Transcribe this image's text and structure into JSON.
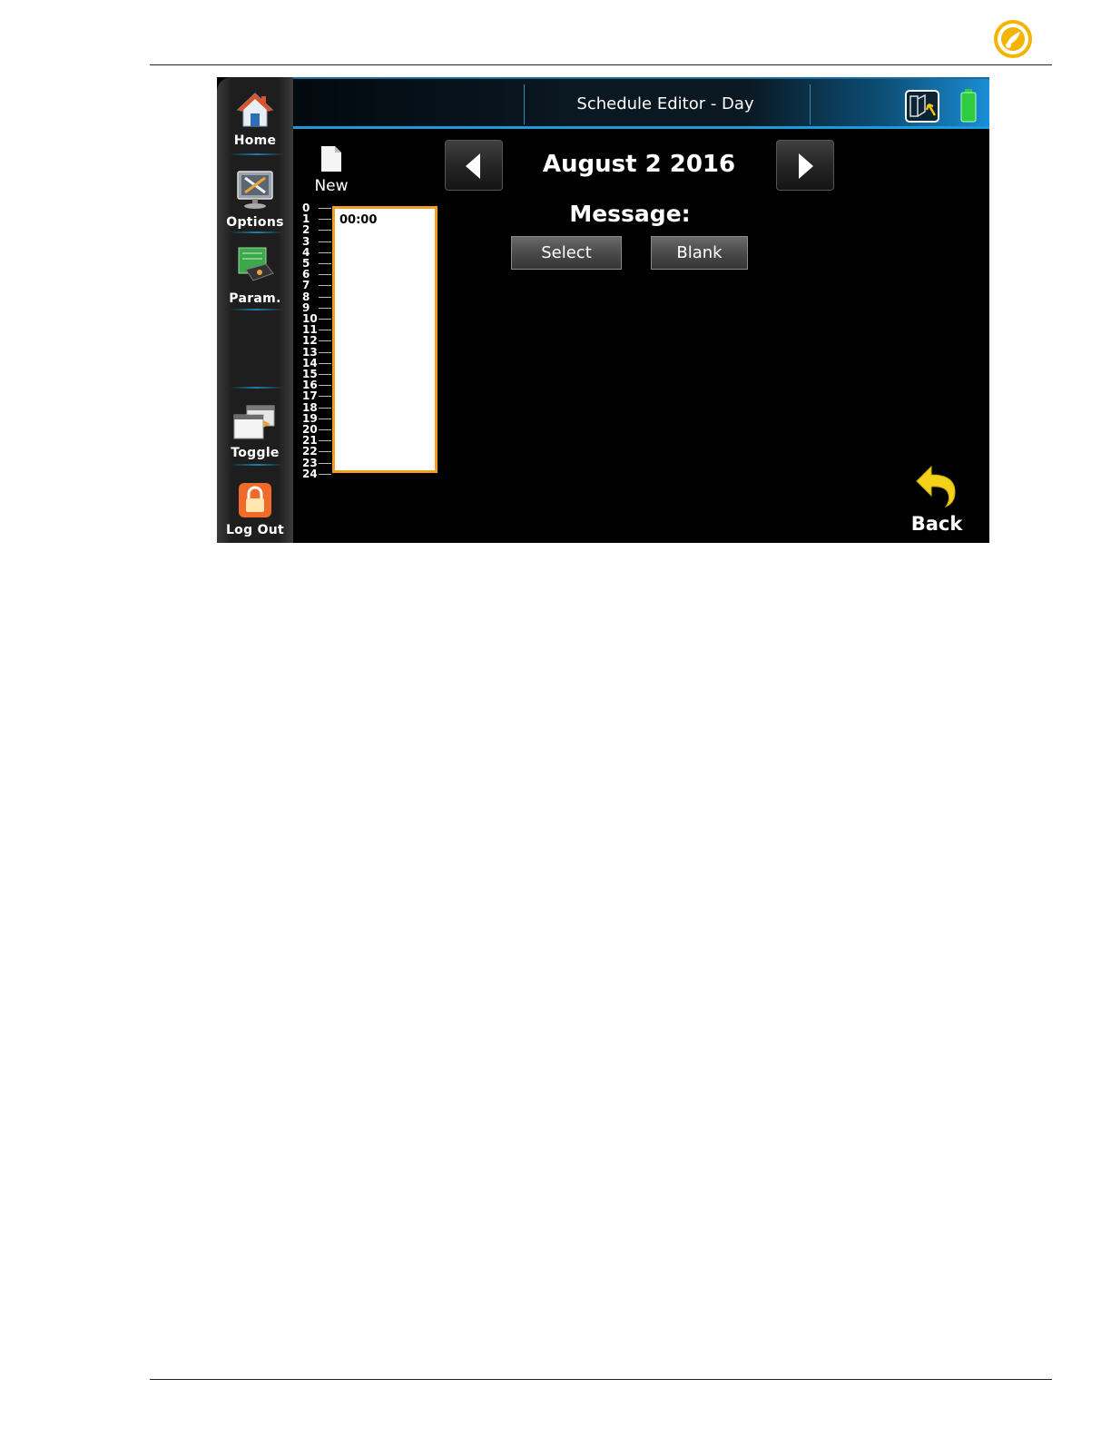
{
  "screen": {
    "title": "Schedule Editor - Day",
    "date": "August 2 2016",
    "message_label": "Message:",
    "new_label": "New",
    "select_label": "Select",
    "blank_label": "Blank",
    "back_label": "Back",
    "day_entry_time": "00:00",
    "hours": [
      "0",
      "1",
      "2",
      "3",
      "4",
      "5",
      "6",
      "7",
      "8",
      "9",
      "10",
      "11",
      "12",
      "13",
      "14",
      "15",
      "16",
      "17",
      "18",
      "19",
      "20",
      "21",
      "22",
      "23",
      "24"
    ]
  },
  "sidebar": {
    "items": [
      {
        "label": "Home",
        "icon": "home-icon"
      },
      {
        "label": "Options",
        "icon": "options-icon"
      },
      {
        "label": "Param.",
        "icon": "parameters-icon"
      },
      {
        "label": "Toggle",
        "icon": "toggle-icon"
      },
      {
        "label": "Log Out",
        "icon": "lock-icon"
      }
    ]
  },
  "colors": {
    "accent_blue": "#1f9ad8",
    "highlight_orange": "#f0a020",
    "battery_green": "#2ecc40"
  }
}
